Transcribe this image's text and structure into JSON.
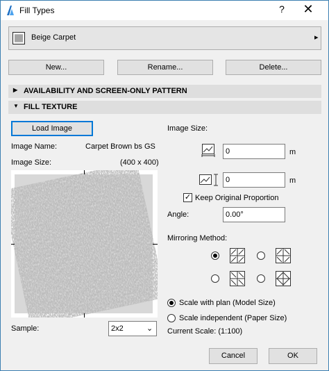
{
  "window": {
    "title": "Fill Types",
    "help": "?",
    "close": "✕"
  },
  "fill_selector": {
    "value": "Beige Carpet",
    "arrow": "▸"
  },
  "buttons": {
    "new": "New...",
    "rename": "Rename...",
    "delete": "Delete..."
  },
  "sections": {
    "availability": "AVAILABILITY AND SCREEN-ONLY PATTERN",
    "fill_texture": "FILL TEXTURE"
  },
  "texture": {
    "load_image": "Load Image",
    "image_name_label": "Image Name:",
    "image_name_value": "Carpet Brown bs GS",
    "image_size_label": "Image Size:",
    "image_size_value": "(400 x 400)",
    "sample_label": "Sample:",
    "sample_value": "2x2"
  },
  "right": {
    "image_size_title": "Image Size:",
    "width_value": "0",
    "height_value": "0",
    "unit": "m",
    "keep_proportion": "Keep Original Proportion",
    "keep_proportion_checked": true,
    "angle_label": "Angle:",
    "angle_value": "0.00°",
    "mirroring_label": "Mirroring Method:",
    "scale_plan": "Scale with plan (Model Size)",
    "scale_independent": "Scale independent (Paper Size)",
    "current_scale": "Current Scale: (1:100)"
  },
  "footer": {
    "cancel": "Cancel",
    "ok": "OK"
  }
}
